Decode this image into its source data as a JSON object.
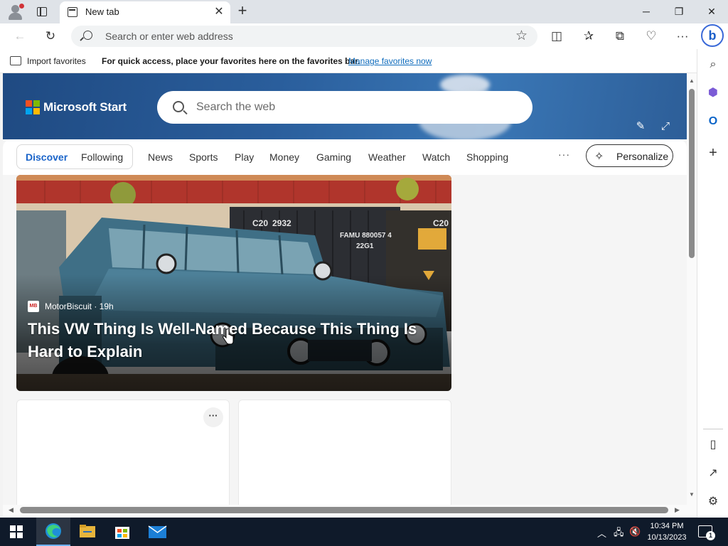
{
  "browser": {
    "tab_title": "New tab",
    "address_placeholder": "Search or enter web address"
  },
  "favorites_bar": {
    "import_label": "Import favorites",
    "quick_access_text": "For quick access, place your favorites here on the favorites bar.",
    "manage_link": "Manage favorites now"
  },
  "start_page": {
    "brand": "Microsoft Start",
    "search_placeholder": "Search the web",
    "nav": {
      "discover": "Discover",
      "following": "Following",
      "items": [
        "News",
        "Sports",
        "Play",
        "Money",
        "Gaming",
        "Weather",
        "Watch",
        "Shopping"
      ],
      "more": "···",
      "personalize": "Personalize"
    },
    "featured": {
      "source": "MotorBiscuit · 19h",
      "source_logo": "MB",
      "headline": "This VW Thing Is Well-Named Because This Thing Is Hard to Explain",
      "scene_labels": {
        "container_1": "C20",
        "container_1b": "2932",
        "container_2a": "FAMU 880057 4",
        "container_2b": "22G1",
        "container_3": "C20"
      }
    },
    "card_menu": "···"
  },
  "taskbar": {
    "time": "10:34 PM",
    "date": "10/13/2023",
    "notification_count": "1"
  },
  "colors": {
    "accent": "#1a64c9",
    "link": "#0f6cbd",
    "taskbar": "#0f1a2a"
  }
}
